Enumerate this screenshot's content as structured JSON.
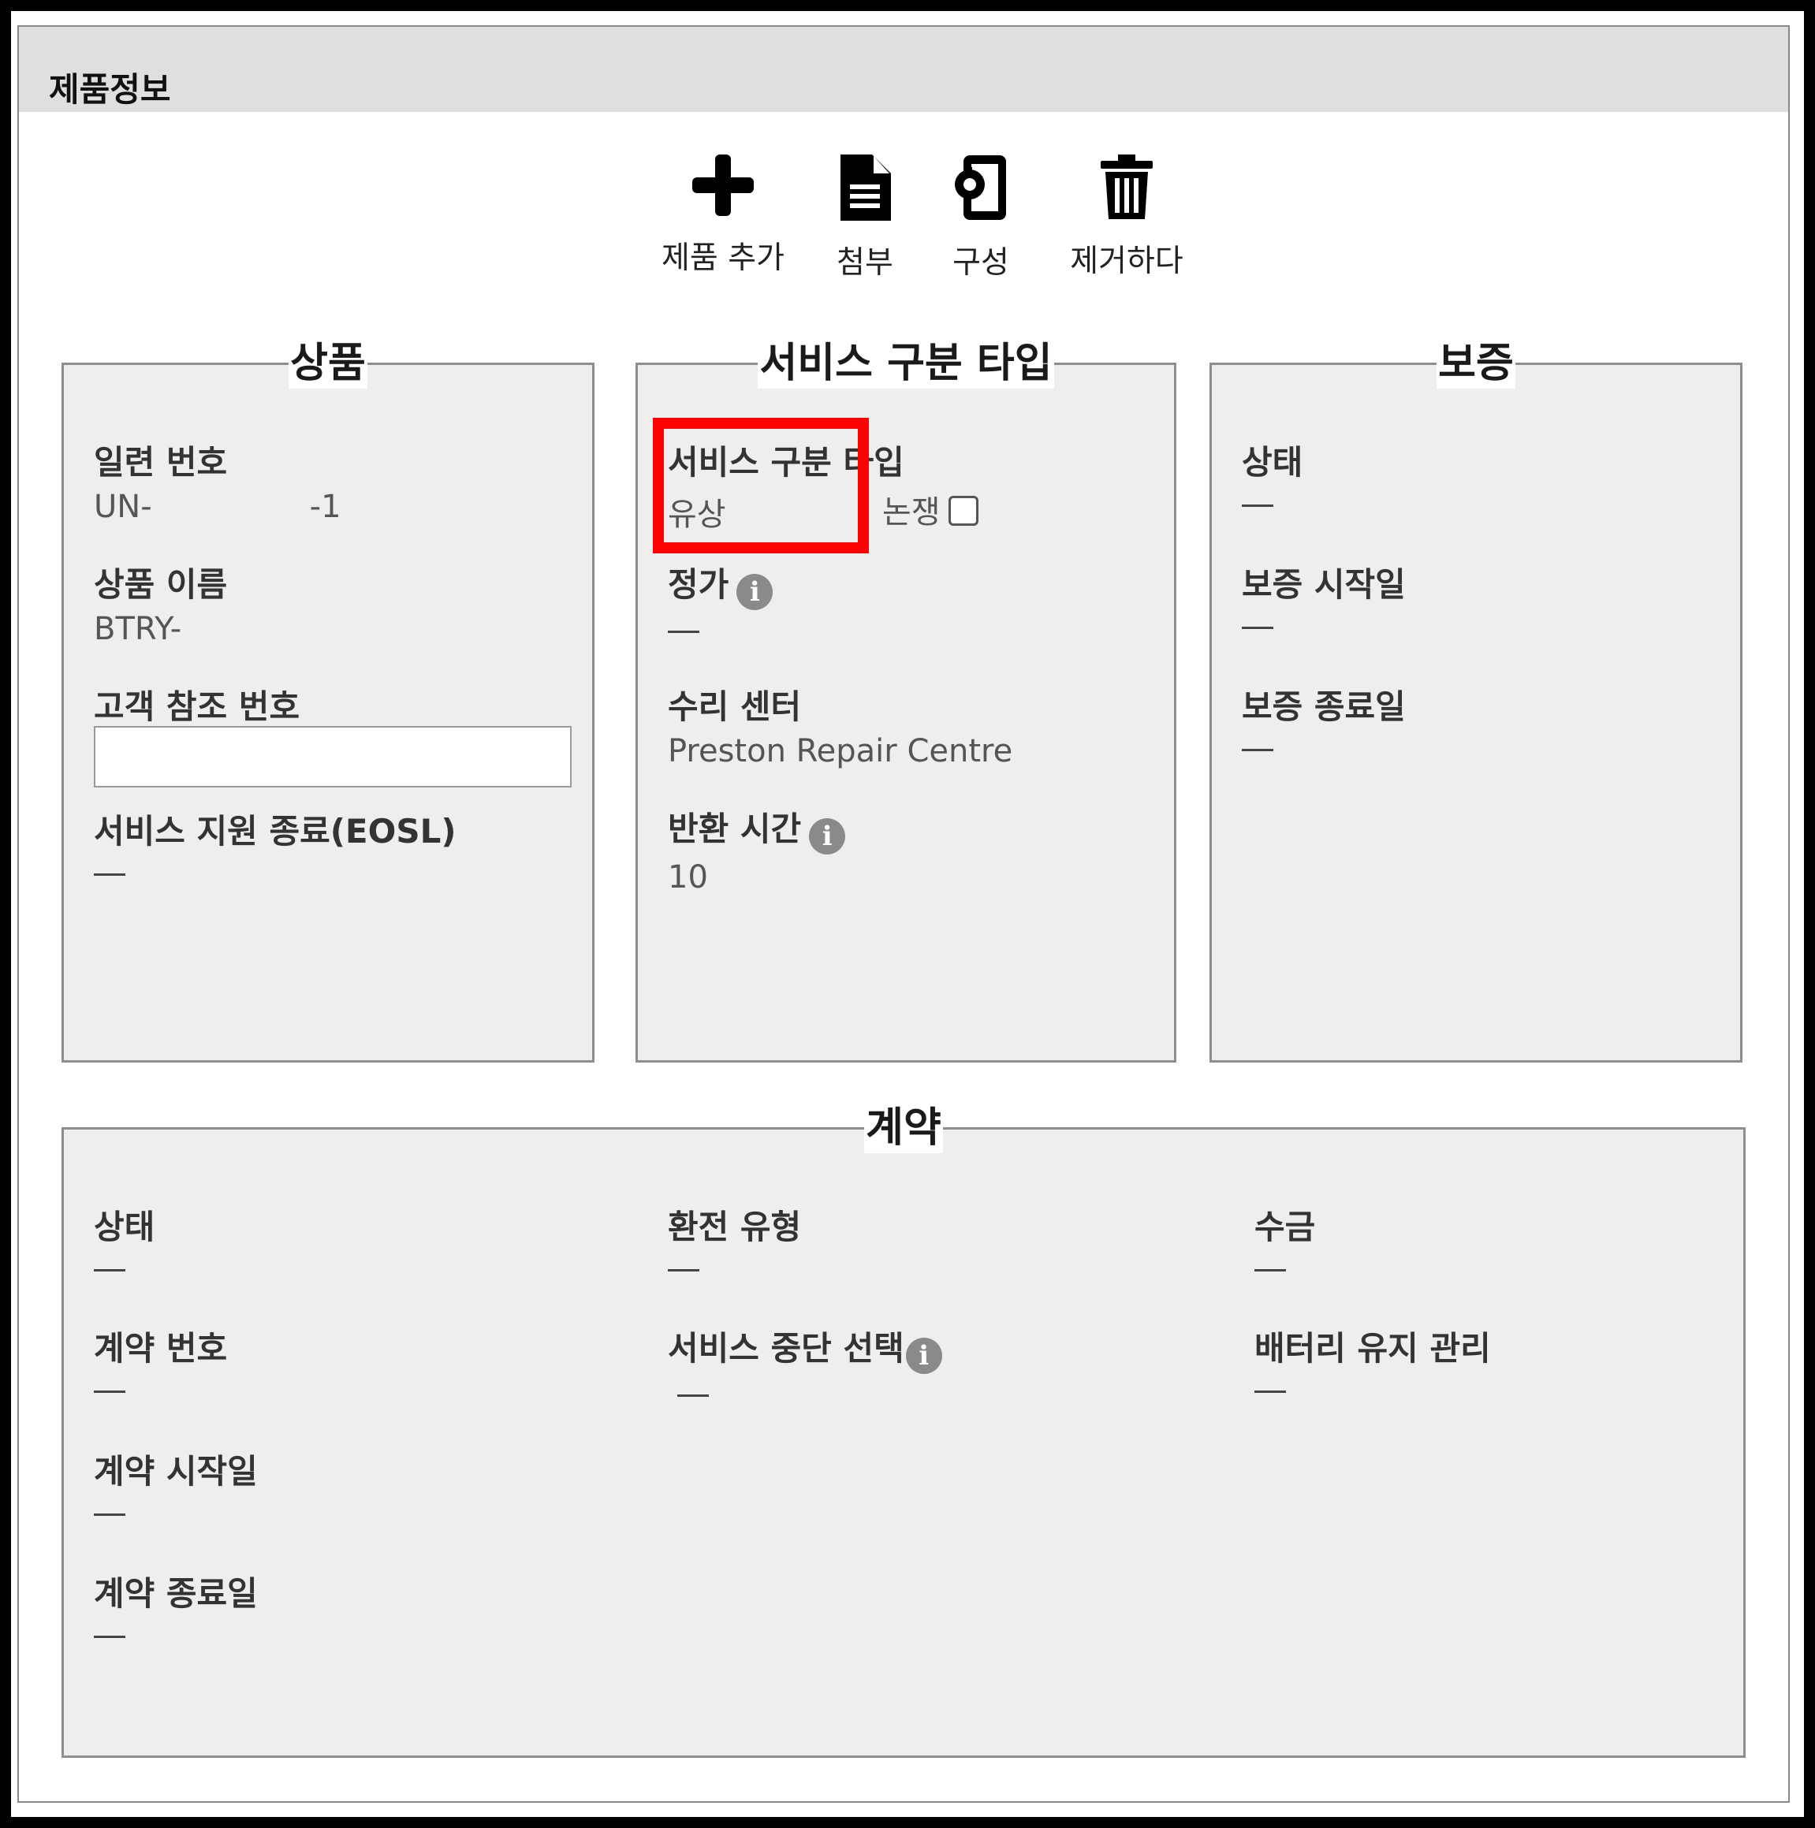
{
  "header": {
    "title": "제품정보"
  },
  "toolbar": {
    "add_label": "제품 추가",
    "attach_label": "첨부",
    "config_label": "구성",
    "remove_label": "제거하다"
  },
  "product": {
    "legend": "상품",
    "serial_label": "일련 번호",
    "serial_prefix": "UN-",
    "serial_suffix": "-1",
    "name_label": "상품 이름",
    "name_value": "BTRY-",
    "customer_ref_label": "고객 참조 번호",
    "customer_ref_value": "",
    "eosl_label": "서비스 지원 종료(EOSL)",
    "eosl_value": "—"
  },
  "service": {
    "legend": "서비스 구분 타입",
    "type_label": "서비스 구분 타입",
    "type_value": "유상",
    "dispute_label": "논쟁",
    "dispute_checked": false,
    "price_label": "정가",
    "price_value": "—",
    "repair_center_label": "수리 센터",
    "repair_center_value": "Preston Repair Centre",
    "return_time_label": "반환 시간",
    "return_time_value": "10"
  },
  "warranty": {
    "legend": "보증",
    "status_label": "상태",
    "status_value": "—",
    "start_label": "보증 시작일",
    "start_value": "—",
    "end_label": "보증 종료일",
    "end_value": "—"
  },
  "contract": {
    "legend": "계약",
    "status_label": "상태",
    "status_value": "—",
    "number_label": "계약 번호",
    "number_value": "—",
    "start_label": "계약 시작일",
    "start_value": "—",
    "end_label": "계약 종료일",
    "end_value": "—",
    "refund_label": "환전 유형",
    "refund_value": "—",
    "suspension_label": "서비스 중단 선택",
    "suspension_value": "—",
    "collection_label": "수금",
    "collection_value": "—",
    "battery_label": "배터리 유지 관리",
    "battery_value": "—"
  },
  "info_glyph": "i",
  "colors": {
    "highlight": "#ff0000",
    "panel_bg": "#eeeeee",
    "titlebar_bg": "#dfdfdf"
  }
}
